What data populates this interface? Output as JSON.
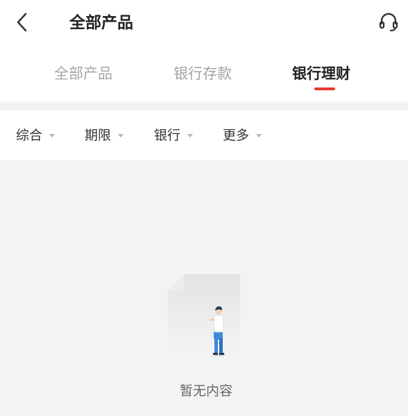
{
  "header": {
    "title": "全部产品",
    "back_icon": "chevron-left-icon",
    "support_icon": "headset-icon"
  },
  "tabs": [
    {
      "label": "全部产品",
      "active": false
    },
    {
      "label": "银行存款",
      "active": false
    },
    {
      "label": "银行理财",
      "active": true
    }
  ],
  "filters": [
    {
      "label": "综合"
    },
    {
      "label": "期限"
    },
    {
      "label": "银行"
    },
    {
      "label": "更多"
    }
  ],
  "empty_state": {
    "message": "暂无内容",
    "illustration": "empty-page-person-icon"
  },
  "colors": {
    "accent": "#e8392f",
    "background": "#f2f3f5",
    "active_text": "#222222",
    "inactive_text": "#a4a4a4"
  }
}
